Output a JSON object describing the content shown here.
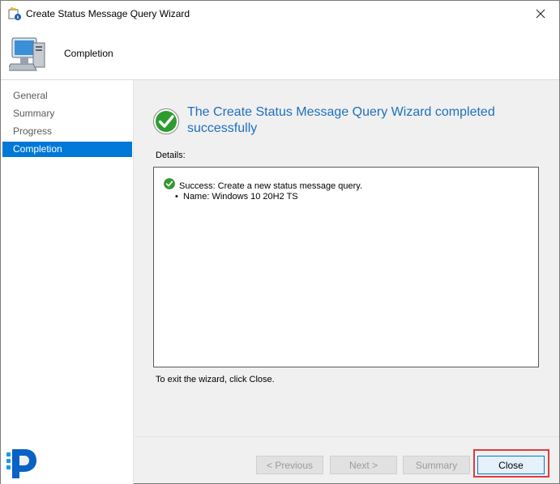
{
  "window": {
    "title": "Create Status Message Query Wizard"
  },
  "header": {
    "title": "Completion"
  },
  "nav": {
    "items": [
      {
        "label": "General",
        "active": false
      },
      {
        "label": "Summary",
        "active": false
      },
      {
        "label": "Progress",
        "active": false
      },
      {
        "label": "Completion",
        "active": true
      }
    ]
  },
  "main": {
    "headline": "The Create Status Message Query Wizard completed successfully",
    "details_label": "Details:",
    "detail_success": "Success: Create a new status message query.",
    "detail_name": "Name: Windows 10 20H2 TS",
    "exit_text": "To exit the wizard, click Close."
  },
  "buttons": {
    "previous": "< Previous",
    "next": "Next >",
    "summary": "Summary",
    "close": "Close"
  },
  "colors": {
    "accent": "#0078d7",
    "headline": "#1e6fbf",
    "success_green": "#2e9b2e",
    "highlight": "#e03c3c"
  }
}
